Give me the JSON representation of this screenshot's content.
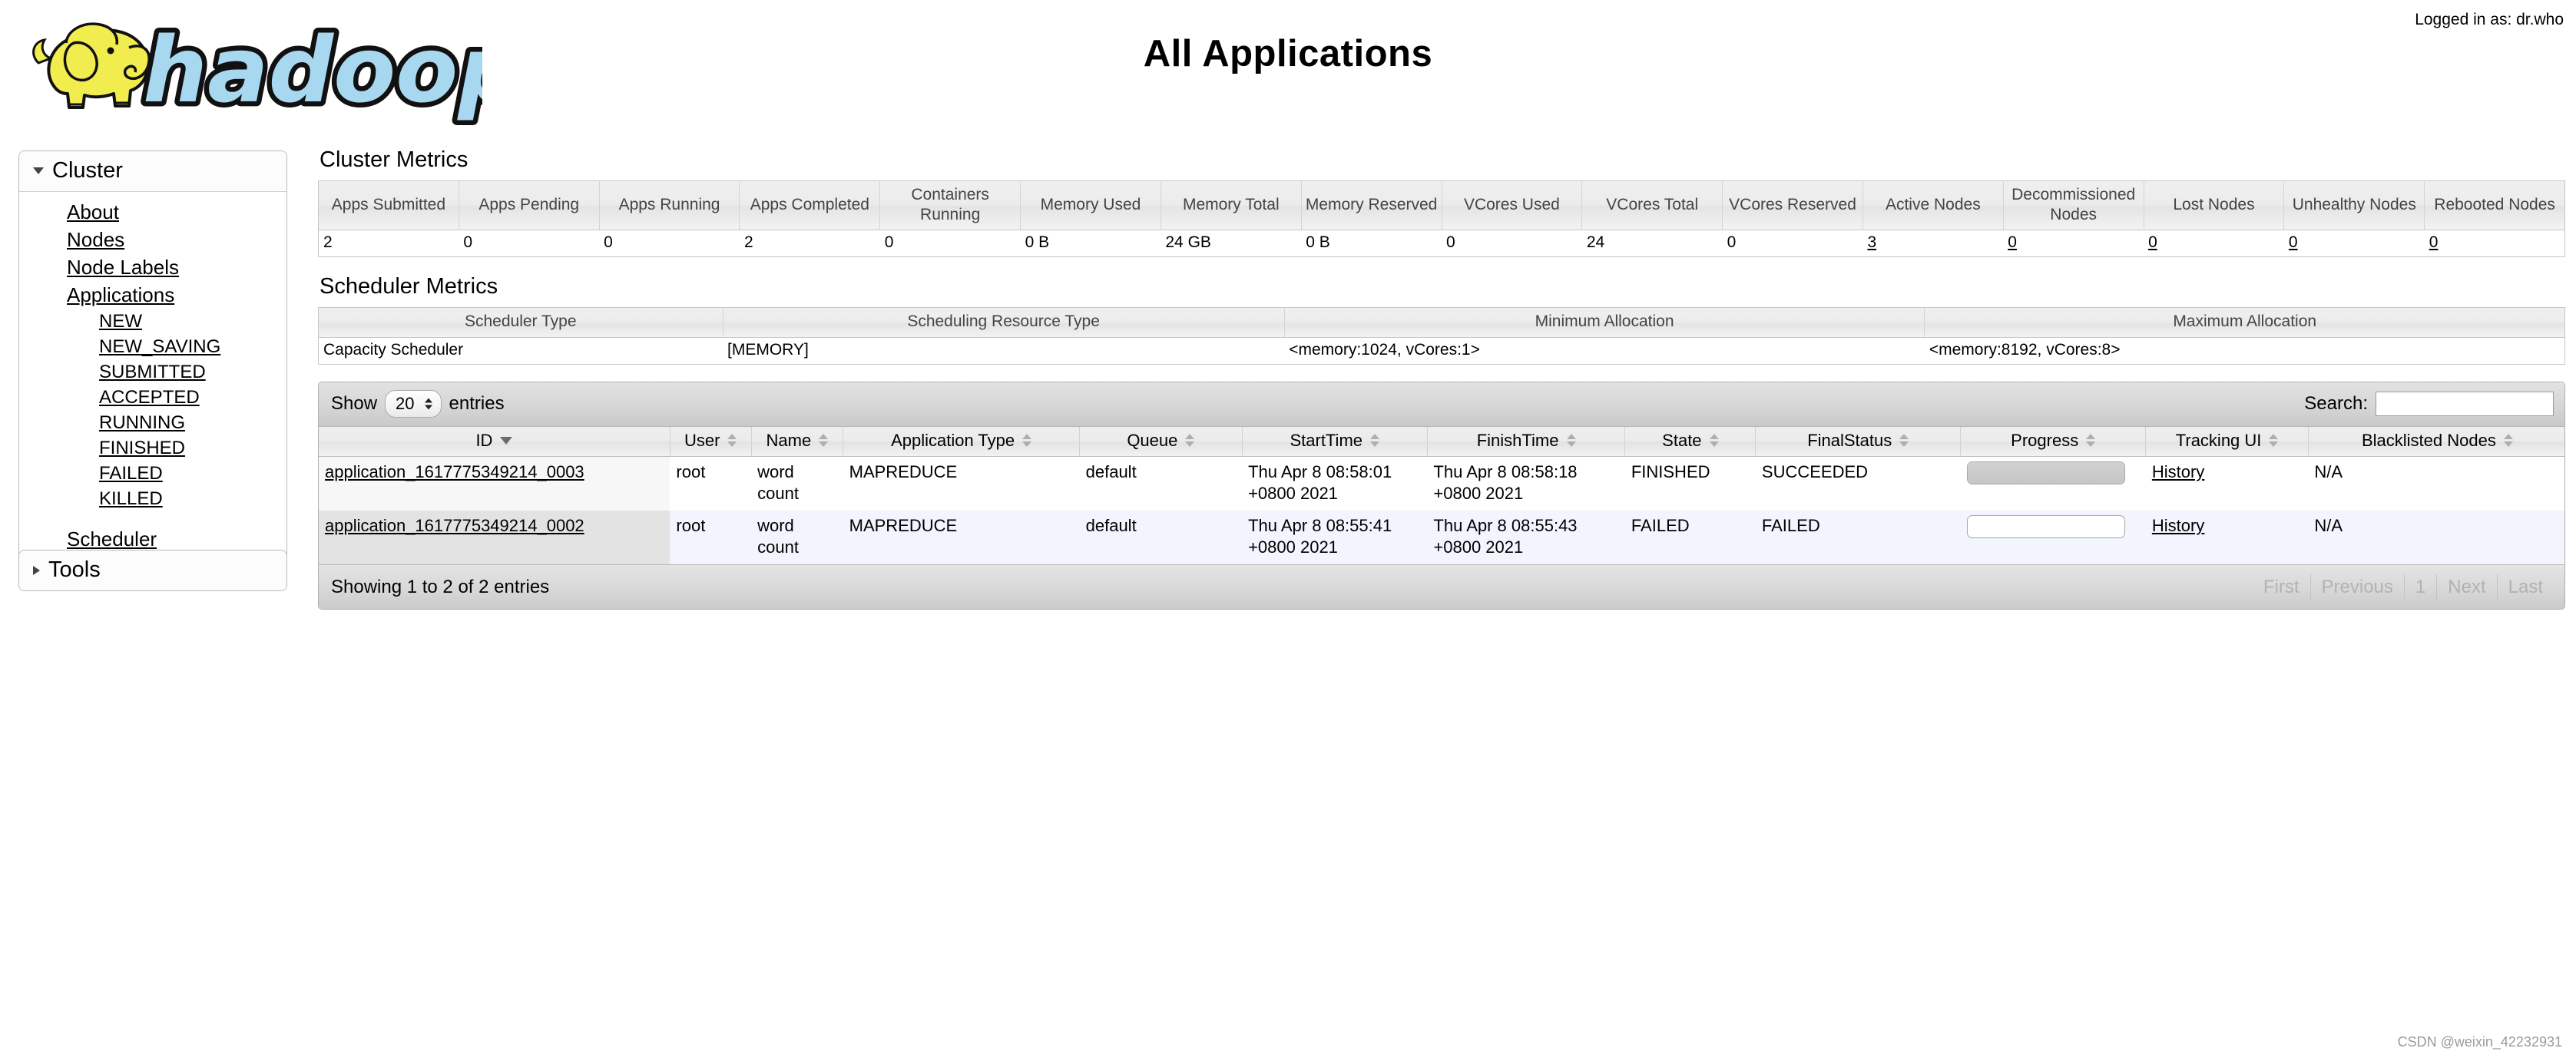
{
  "header": {
    "title": "All Applications",
    "login_text": "Logged in as: dr.who",
    "logo_text": "hadoop",
    "logo_colors": {
      "elephant": "#f2ed4e",
      "wordmark": "#a8d8f0",
      "outline": "#111111"
    }
  },
  "sidebar": {
    "cluster_group": {
      "label": "Cluster",
      "items": [
        {
          "label": "About",
          "level": 1
        },
        {
          "label": "Nodes",
          "level": 1
        },
        {
          "label": "Node Labels",
          "level": 1
        },
        {
          "label": "Applications",
          "level": 1
        },
        {
          "label": "NEW",
          "level": 2
        },
        {
          "label": "NEW_SAVING",
          "level": 2
        },
        {
          "label": "SUBMITTED",
          "level": 2
        },
        {
          "label": "ACCEPTED",
          "level": 2
        },
        {
          "label": "RUNNING",
          "level": 2
        },
        {
          "label": "FINISHED",
          "level": 2
        },
        {
          "label": "FAILED",
          "level": 2
        },
        {
          "label": "KILLED",
          "level": 2
        },
        {
          "label": "Scheduler",
          "level": 1,
          "spaced": true
        }
      ]
    },
    "tools_group": {
      "label": "Tools"
    }
  },
  "cluster_metrics": {
    "title": "Cluster Metrics",
    "columns": [
      "Apps Submitted",
      "Apps Pending",
      "Apps Running",
      "Apps Completed",
      "Containers Running",
      "Memory Used",
      "Memory Total",
      "Memory Reserved",
      "VCores Used",
      "VCores Total",
      "VCores Reserved",
      "Active Nodes",
      "Decommissioned Nodes",
      "Lost Nodes",
      "Unhealthy Nodes",
      "Rebooted Nodes"
    ],
    "values": [
      {
        "text": "2",
        "link": false,
        "align": "left"
      },
      {
        "text": "0",
        "link": false,
        "align": "left"
      },
      {
        "text": "0",
        "link": false,
        "align": "left"
      },
      {
        "text": "2",
        "link": false,
        "align": "left"
      },
      {
        "text": "0",
        "link": false,
        "align": "left"
      },
      {
        "text": "0 B",
        "link": false,
        "align": "right"
      },
      {
        "text": "24 GB",
        "link": false,
        "align": "right"
      },
      {
        "text": "0 B",
        "link": false,
        "align": "left"
      },
      {
        "text": "0",
        "link": false,
        "align": "left"
      },
      {
        "text": "24",
        "link": false,
        "align": "left"
      },
      {
        "text": "0",
        "link": false,
        "align": "left"
      },
      {
        "text": "3",
        "link": true,
        "align": "left"
      },
      {
        "text": "0",
        "link": true,
        "align": "left"
      },
      {
        "text": "0",
        "link": true,
        "align": "left"
      },
      {
        "text": "0",
        "link": true,
        "align": "left"
      },
      {
        "text": "0",
        "link": true,
        "align": "left"
      }
    ]
  },
  "scheduler_metrics": {
    "title": "Scheduler Metrics",
    "columns": [
      "Scheduler Type",
      "Scheduling Resource Type",
      "Minimum Allocation",
      "Maximum Allocation"
    ],
    "row": [
      "Capacity Scheduler",
      "[MEMORY]",
      "<memory:1024, vCores:1>",
      "<memory:8192, vCores:8>"
    ]
  },
  "apps_table": {
    "show_label": "Show",
    "entries_label": "entries",
    "page_length": "20",
    "search_label": "Search:",
    "search_value": "",
    "search_placeholder": "",
    "columns": [
      {
        "label": "ID",
        "sort": "desc"
      },
      {
        "label": "User",
        "sort": "both"
      },
      {
        "label": "Name",
        "sort": "both"
      },
      {
        "label": "Application Type",
        "sort": "both"
      },
      {
        "label": "Queue",
        "sort": "both"
      },
      {
        "label": "StartTime",
        "sort": "both"
      },
      {
        "label": "FinishTime",
        "sort": "both"
      },
      {
        "label": "State",
        "sort": "both"
      },
      {
        "label": "FinalStatus",
        "sort": "both"
      },
      {
        "label": "Progress",
        "sort": "both"
      },
      {
        "label": "Tracking UI",
        "sort": "both"
      },
      {
        "label": "Blacklisted Nodes",
        "sort": "both"
      }
    ],
    "rows": [
      {
        "id": "application_1617775349214_0003",
        "user": "root",
        "name": "word count",
        "app_type": "MAPREDUCE",
        "queue": "default",
        "start_time": "Thu Apr 8 08:58:01 +0800 2021",
        "finish_time": "Thu Apr 8 08:58:18 +0800 2021",
        "state": "FINISHED",
        "final_status": "SUCCEEDED",
        "progress": 100,
        "tracking_ui": "History",
        "blacklisted_nodes": "N/A"
      },
      {
        "id": "application_1617775349214_0002",
        "user": "root",
        "name": "word count",
        "app_type": "MAPREDUCE",
        "queue": "default",
        "start_time": "Thu Apr 8 08:55:41 +0800 2021",
        "finish_time": "Thu Apr 8 08:55:43 +0800 2021",
        "state": "FAILED",
        "final_status": "FAILED",
        "progress": 0,
        "tracking_ui": "History",
        "blacklisted_nodes": "N/A"
      }
    ],
    "footer_info": "Showing 1 to 2 of 2 entries",
    "pagination": [
      "First",
      "Previous",
      "1",
      "Next",
      "Last"
    ]
  },
  "watermark": "CSDN @weixin_42232931"
}
